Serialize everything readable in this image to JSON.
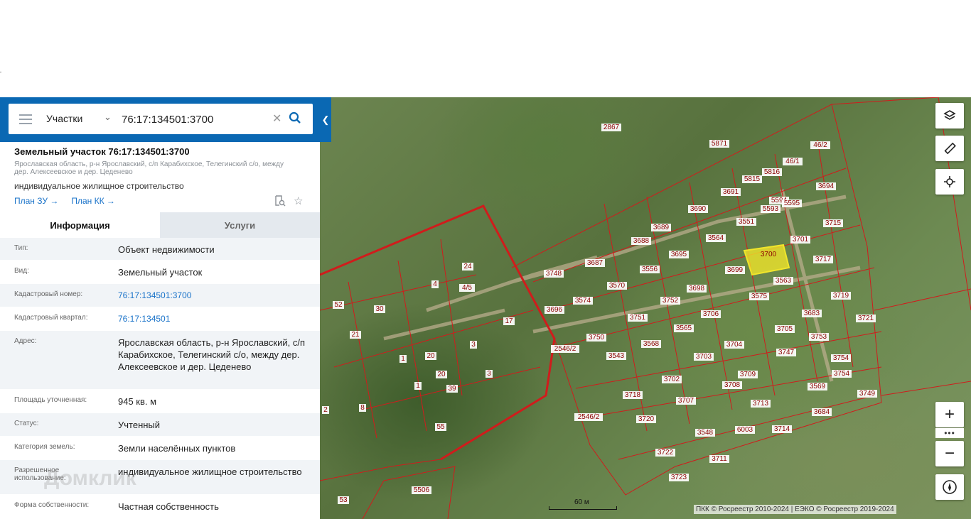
{
  "search": {
    "type_label": "Участки",
    "value": "76:17:134501:3700"
  },
  "object": {
    "title": "Земельный участок 76:17:134501:3700",
    "address_short": "Ярославская область, р-н Ярославский, с/п Карабихское, Телегинский с/о, между дер. Алексеевское и дер. Цеденево",
    "purpose": "индивидуальное жилищное строительство",
    "link_plan_zu": "План ЗУ →",
    "link_plan_kk": "План КК →"
  },
  "tabs": {
    "info": "Информация",
    "services": "Услуги"
  },
  "details": [
    {
      "key": "Тип:",
      "value": "Объект недвижимости",
      "link": false
    },
    {
      "key": "Вид:",
      "value": "Земельный участок",
      "link": false
    },
    {
      "key": "Кадастровый номер:",
      "value": "76:17:134501:3700",
      "link": true
    },
    {
      "key": "Кадастровый квартал:",
      "value": "76:17:134501",
      "link": true
    },
    {
      "key": "Адрес:",
      "value": "Ярославская область, р-н Ярославский, с/п Карабихское, Телегинский с/о, между дер. Алексеевское и дер. Цеденево",
      "link": false
    },
    {
      "key": "Площадь уточненная:",
      "value": "945 кв. м",
      "link": false
    },
    {
      "key": "Статус:",
      "value": "Учтенный",
      "link": false
    },
    {
      "key": "Категория земель:",
      "value": "Земли населённых пунктов",
      "link": false
    },
    {
      "key": "Разрешенное использование:",
      "value": "индивидуальное жилищное строительство",
      "link": false
    },
    {
      "key": "Форма собственности:",
      "value": "Частная собственность",
      "link": false
    }
  ],
  "watermark": "Домклик",
  "map": {
    "selected_parcel": "3700",
    "parcel_labels": [
      "2867",
      "5871",
      "46/2",
      "46/1",
      "5816",
      "5815",
      "3694",
      "3691",
      "3690",
      "5594",
      "5595",
      "5593",
      "3551",
      "3715",
      "3689",
      "3688",
      "3564",
      "3701",
      "3695",
      "3687",
      "3700",
      "3699",
      "3717",
      "3748",
      "3556",
      "3563",
      "3570",
      "3698",
      "3574",
      "3575",
      "3719",
      "3752",
      "3696",
      "3706",
      "3683",
      "3751",
      "3721",
      "3565",
      "3705",
      "2546/2",
      "3750",
      "3753",
      "3568",
      "3704",
      "3543",
      "3747",
      "3703",
      "3754",
      "3702",
      "3709",
      "3708",
      "3569",
      "3754",
      "3718",
      "3707",
      "3749",
      "3713",
      "3684",
      "2546/2",
      "3720",
      "3548",
      "6003",
      "3714",
      "3722",
      "3711",
      "3723",
      "52",
      "30",
      "21",
      "4",
      "24",
      "4/5",
      "17",
      "3",
      "1",
      "20",
      "20",
      "39",
      "3",
      "1",
      "8",
      "2",
      "55",
      "5506",
      "53"
    ],
    "scale_label": "60 м",
    "attribution": "ПКК © Росреестр 2010-2024 | ЕЭКО © Росреестр 2019-2024",
    "zoom_in": "+",
    "zoom_out": "−",
    "more": "•••",
    "colors": {
      "boundary": "#d01c1c",
      "selected_fill": "#f0e52b",
      "label_text": "#8b0000"
    }
  }
}
